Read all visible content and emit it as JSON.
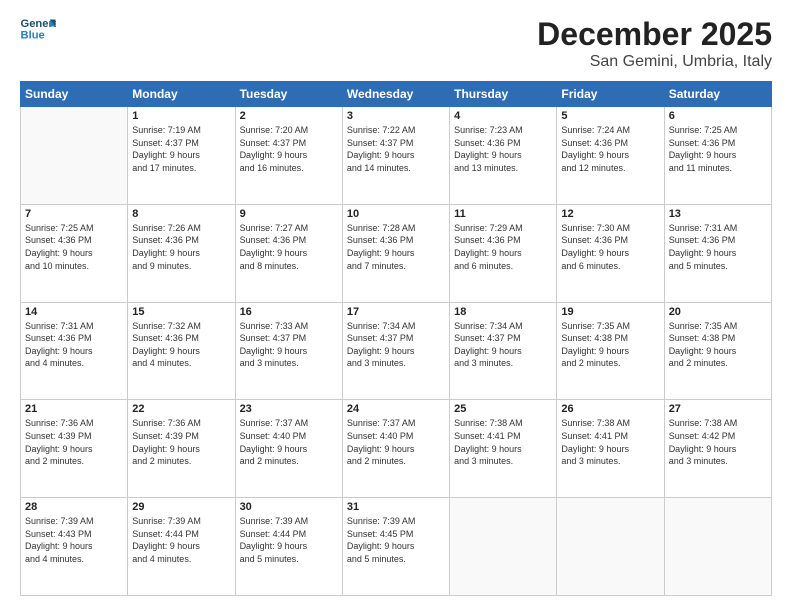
{
  "header": {
    "logo": {
      "general": "General",
      "blue": "Blue"
    },
    "month": "December 2025",
    "location": "San Gemini, Umbria, Italy"
  },
  "weekdays": [
    "Sunday",
    "Monday",
    "Tuesday",
    "Wednesday",
    "Thursday",
    "Friday",
    "Saturday"
  ],
  "weeks": [
    [
      {
        "day": "",
        "info": ""
      },
      {
        "day": "1",
        "info": "Sunrise: 7:19 AM\nSunset: 4:37 PM\nDaylight: 9 hours\nand 17 minutes."
      },
      {
        "day": "2",
        "info": "Sunrise: 7:20 AM\nSunset: 4:37 PM\nDaylight: 9 hours\nand 16 minutes."
      },
      {
        "day": "3",
        "info": "Sunrise: 7:22 AM\nSunset: 4:37 PM\nDaylight: 9 hours\nand 14 minutes."
      },
      {
        "day": "4",
        "info": "Sunrise: 7:23 AM\nSunset: 4:36 PM\nDaylight: 9 hours\nand 13 minutes."
      },
      {
        "day": "5",
        "info": "Sunrise: 7:24 AM\nSunset: 4:36 PM\nDaylight: 9 hours\nand 12 minutes."
      },
      {
        "day": "6",
        "info": "Sunrise: 7:25 AM\nSunset: 4:36 PM\nDaylight: 9 hours\nand 11 minutes."
      }
    ],
    [
      {
        "day": "7",
        "info": "Sunrise: 7:25 AM\nSunset: 4:36 PM\nDaylight: 9 hours\nand 10 minutes."
      },
      {
        "day": "8",
        "info": "Sunrise: 7:26 AM\nSunset: 4:36 PM\nDaylight: 9 hours\nand 9 minutes."
      },
      {
        "day": "9",
        "info": "Sunrise: 7:27 AM\nSunset: 4:36 PM\nDaylight: 9 hours\nand 8 minutes."
      },
      {
        "day": "10",
        "info": "Sunrise: 7:28 AM\nSunset: 4:36 PM\nDaylight: 9 hours\nand 7 minutes."
      },
      {
        "day": "11",
        "info": "Sunrise: 7:29 AM\nSunset: 4:36 PM\nDaylight: 9 hours\nand 6 minutes."
      },
      {
        "day": "12",
        "info": "Sunrise: 7:30 AM\nSunset: 4:36 PM\nDaylight: 9 hours\nand 6 minutes."
      },
      {
        "day": "13",
        "info": "Sunrise: 7:31 AM\nSunset: 4:36 PM\nDaylight: 9 hours\nand 5 minutes."
      }
    ],
    [
      {
        "day": "14",
        "info": "Sunrise: 7:31 AM\nSunset: 4:36 PM\nDaylight: 9 hours\nand 4 minutes."
      },
      {
        "day": "15",
        "info": "Sunrise: 7:32 AM\nSunset: 4:36 PM\nDaylight: 9 hours\nand 4 minutes."
      },
      {
        "day": "16",
        "info": "Sunrise: 7:33 AM\nSunset: 4:37 PM\nDaylight: 9 hours\nand 3 minutes."
      },
      {
        "day": "17",
        "info": "Sunrise: 7:34 AM\nSunset: 4:37 PM\nDaylight: 9 hours\nand 3 minutes."
      },
      {
        "day": "18",
        "info": "Sunrise: 7:34 AM\nSunset: 4:37 PM\nDaylight: 9 hours\nand 3 minutes."
      },
      {
        "day": "19",
        "info": "Sunrise: 7:35 AM\nSunset: 4:38 PM\nDaylight: 9 hours\nand 2 minutes."
      },
      {
        "day": "20",
        "info": "Sunrise: 7:35 AM\nSunset: 4:38 PM\nDaylight: 9 hours\nand 2 minutes."
      }
    ],
    [
      {
        "day": "21",
        "info": "Sunrise: 7:36 AM\nSunset: 4:39 PM\nDaylight: 9 hours\nand 2 minutes."
      },
      {
        "day": "22",
        "info": "Sunrise: 7:36 AM\nSunset: 4:39 PM\nDaylight: 9 hours\nand 2 minutes."
      },
      {
        "day": "23",
        "info": "Sunrise: 7:37 AM\nSunset: 4:40 PM\nDaylight: 9 hours\nand 2 minutes."
      },
      {
        "day": "24",
        "info": "Sunrise: 7:37 AM\nSunset: 4:40 PM\nDaylight: 9 hours\nand 2 minutes."
      },
      {
        "day": "25",
        "info": "Sunrise: 7:38 AM\nSunset: 4:41 PM\nDaylight: 9 hours\nand 3 minutes."
      },
      {
        "day": "26",
        "info": "Sunrise: 7:38 AM\nSunset: 4:41 PM\nDaylight: 9 hours\nand 3 minutes."
      },
      {
        "day": "27",
        "info": "Sunrise: 7:38 AM\nSunset: 4:42 PM\nDaylight: 9 hours\nand 3 minutes."
      }
    ],
    [
      {
        "day": "28",
        "info": "Sunrise: 7:39 AM\nSunset: 4:43 PM\nDaylight: 9 hours\nand 4 minutes."
      },
      {
        "day": "29",
        "info": "Sunrise: 7:39 AM\nSunset: 4:44 PM\nDaylight: 9 hours\nand 4 minutes."
      },
      {
        "day": "30",
        "info": "Sunrise: 7:39 AM\nSunset: 4:44 PM\nDaylight: 9 hours\nand 5 minutes."
      },
      {
        "day": "31",
        "info": "Sunrise: 7:39 AM\nSunset: 4:45 PM\nDaylight: 9 hours\nand 5 minutes."
      },
      {
        "day": "",
        "info": ""
      },
      {
        "day": "",
        "info": ""
      },
      {
        "day": "",
        "info": ""
      }
    ]
  ]
}
